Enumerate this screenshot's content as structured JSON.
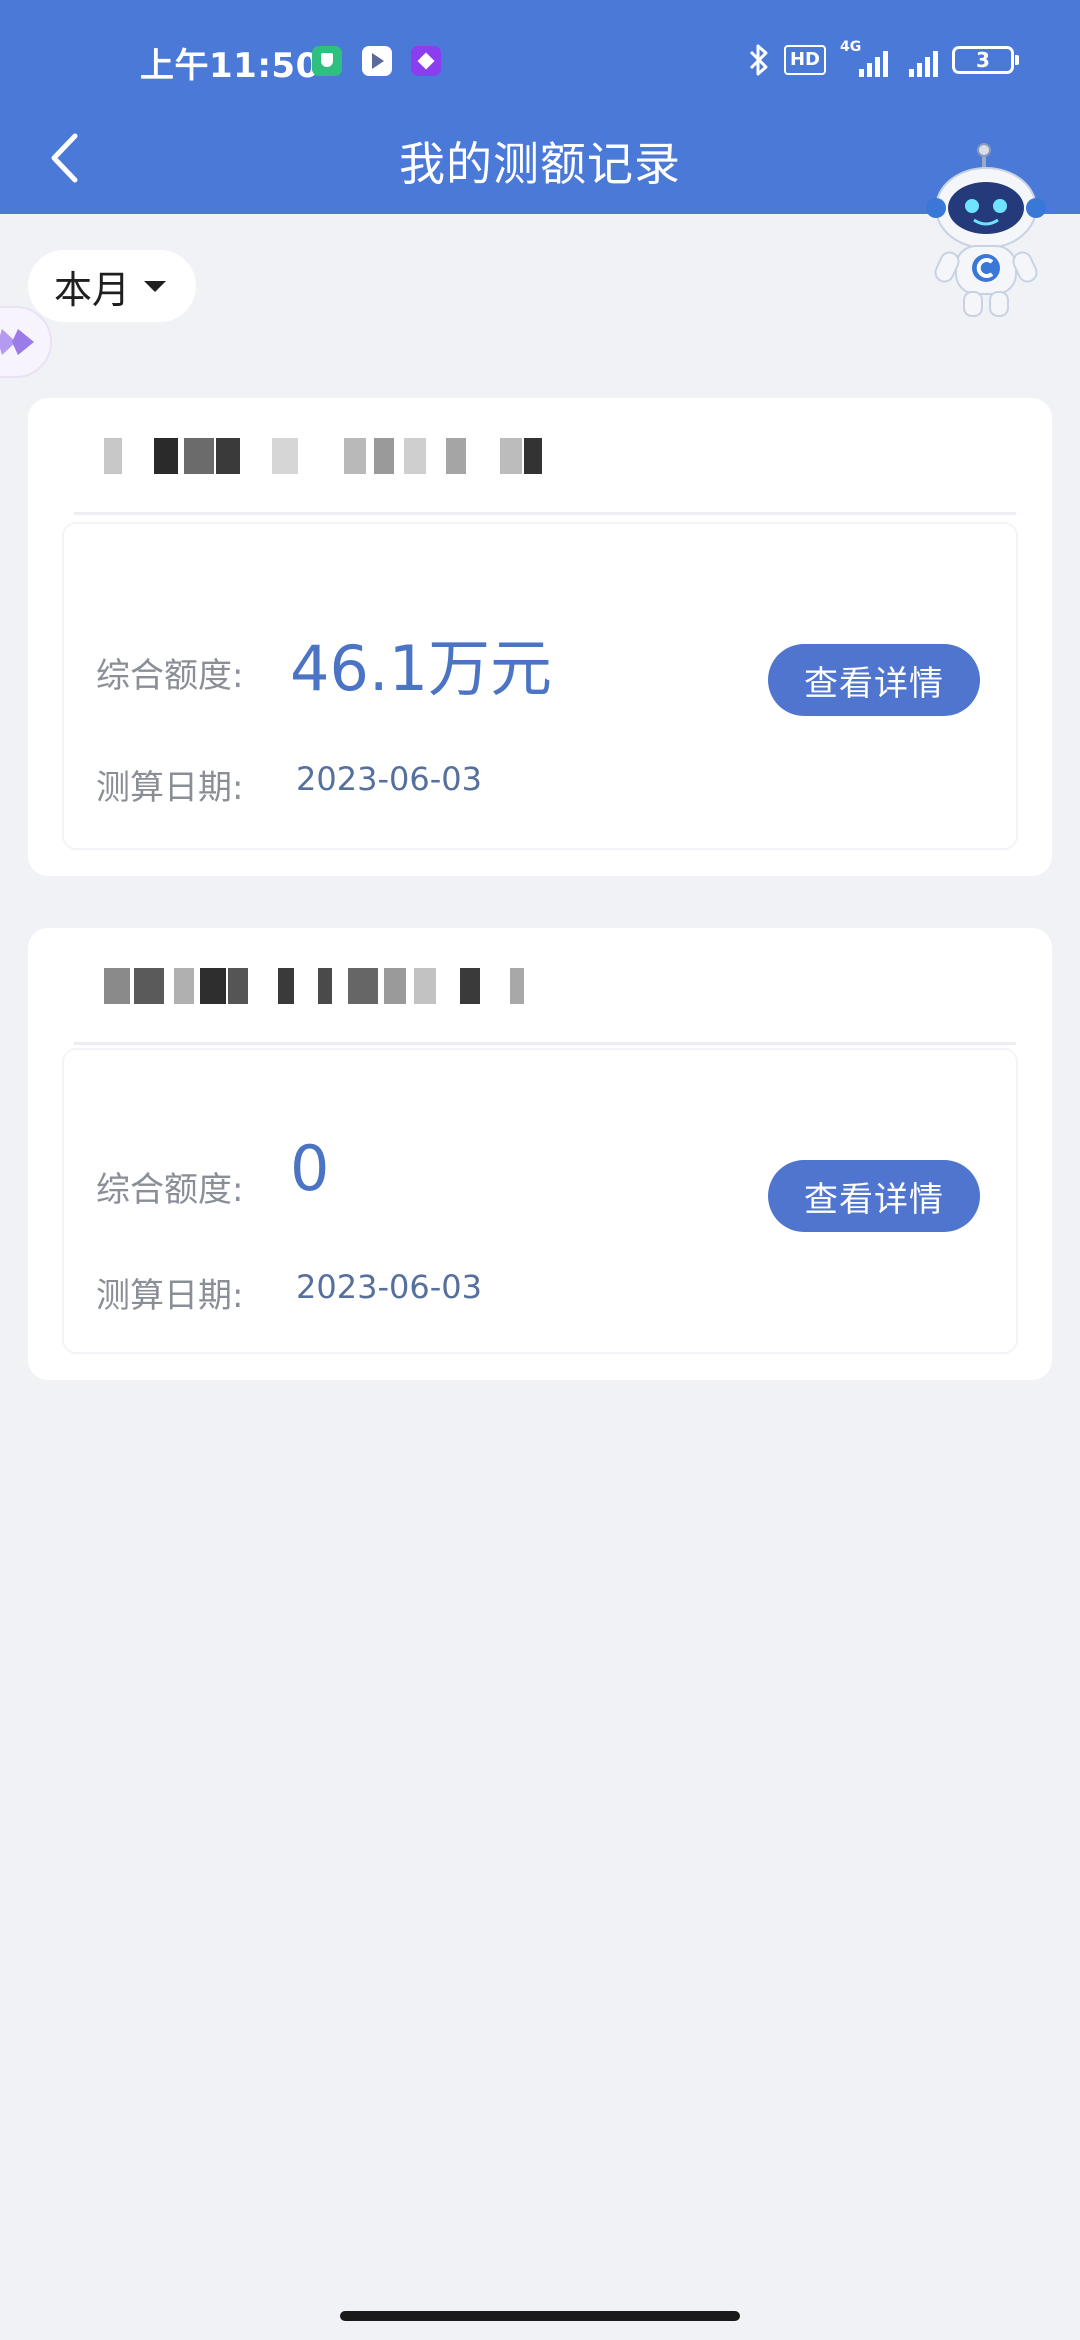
{
  "status_bar": {
    "time": "上午11:50",
    "hd": "HD",
    "network_label": "4G",
    "battery_level": "3"
  },
  "nav": {
    "title": "我的测额记录"
  },
  "filter": {
    "selected": "本月"
  },
  "records": [
    {
      "amount_label": "综合额度:",
      "amount": "46.1万元",
      "date_label": "测算日期:",
      "date": "2023-06-03",
      "button": "查看详情"
    },
    {
      "amount_label": "综合额度:",
      "amount": "0",
      "date_label": "测算日期:",
      "date": "2023-06-03",
      "button": "查看详情"
    }
  ],
  "colors": {
    "brand": "#4b79d8",
    "button": "#4f75cf",
    "amount": "#4b74c4",
    "background": "#f1f2f5"
  },
  "icons": [
    "back-arrow-icon",
    "caret-down-icon",
    "robot-assistant-icon",
    "bluetooth-icon",
    "battery-icon"
  ]
}
